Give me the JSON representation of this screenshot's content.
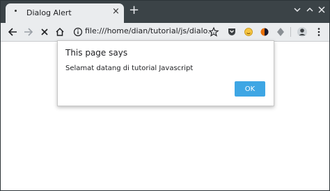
{
  "tab": {
    "title": "Dialog Alert",
    "close_glyph": "×",
    "favicon": "dot-icon"
  },
  "tabstrip": {
    "newtab_glyph": "+"
  },
  "window_controls": [
    "minimize-icon",
    "maximize-icon",
    "close-icon"
  ],
  "toolbar": {
    "url": "file:///home/dian/tutorial/js/dialo...",
    "icons": [
      "back-arrow-icon",
      "forward-arrow-icon",
      "stop-icon",
      "home-icon",
      "info-icon",
      "star-icon",
      "pocket-icon",
      "emoji-icon",
      "extension-icon",
      "extension-icon",
      "profile-avatar",
      "menu-icon"
    ]
  },
  "dialog": {
    "title": "This page says",
    "message": "Selamat datang di tutorial Javascript",
    "ok_label": "OK"
  },
  "colors": {
    "tabstrip_bg": "#3b4347",
    "toolbar_bg": "#eaecee",
    "ok_button": "#3ea6e4"
  }
}
